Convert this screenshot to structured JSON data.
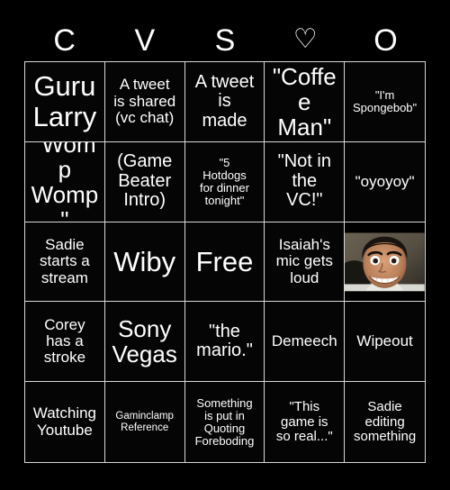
{
  "card": {
    "background_color": "#000000",
    "grid_line_color": "#d8d8d8",
    "text_color": "#ffffff",
    "columns": 5,
    "rows": 5
  },
  "header": {
    "letters": [
      {
        "label": "C",
        "name": "header-letter-c"
      },
      {
        "label": "V",
        "name": "header-letter-v"
      },
      {
        "label": "S",
        "name": "header-letter-s"
      },
      {
        "label": "♡",
        "name": "heart-icon"
      },
      {
        "label": "O",
        "name": "header-letter-o"
      }
    ]
  },
  "grid": {
    "cells": [
      {
        "text": "Guru\nLarry",
        "size": "fs-xxl",
        "type": "text"
      },
      {
        "text": "A tweet\nis shared\n(vc chat)",
        "size": "fs-m",
        "type": "text"
      },
      {
        "text": "A tweet\nis\nmade",
        "size": "fs-l",
        "type": "text"
      },
      {
        "text": "\"Coffee\nMan\"",
        "size": "fs-xl",
        "type": "text"
      },
      {
        "text": "\"I'm\nSpongebob\"",
        "size": "fs-xs",
        "type": "text"
      },
      {
        "text": "\"Womp\nWomp\"",
        "size": "fs-xl",
        "type": "text"
      },
      {
        "text": "(Game\nBeater\nIntro)",
        "size": "fs-l",
        "type": "text"
      },
      {
        "text": "\"5\nHotdogs\nfor dinner\ntonight\"",
        "size": "fs-xs",
        "type": "text"
      },
      {
        "text": "\"Not in\nthe\nVC!\"",
        "size": "fs-l",
        "type": "text"
      },
      {
        "text": "\"oyoyoy\"",
        "size": "fs-m",
        "type": "text"
      },
      {
        "text": "Sadie\nstarts a\nstream",
        "size": "fs-m",
        "type": "text"
      },
      {
        "text": "Wiby",
        "size": "fs-xxl",
        "type": "text"
      },
      {
        "text": "Free",
        "size": "fs-xxl",
        "type": "text"
      },
      {
        "text": "Isaiah's\nmic gets\nloud",
        "size": "fs-m",
        "type": "text"
      },
      {
        "text": "",
        "size": "fs-m",
        "type": "image",
        "image_name": "smiling-man-photo"
      },
      {
        "text": "Corey\nhas a\nstroke",
        "size": "fs-m",
        "type": "text"
      },
      {
        "text": "Sony\nVegas",
        "size": "fs-xl",
        "type": "text"
      },
      {
        "text": "\"the\nmario.\"",
        "size": "fs-l",
        "type": "text"
      },
      {
        "text": "Demeech",
        "size": "fs-m",
        "type": "text"
      },
      {
        "text": "Wipeout",
        "size": "fs-m",
        "type": "text"
      },
      {
        "text": "Watching\nYoutube",
        "size": "fs-m",
        "type": "text"
      },
      {
        "text": "Gaminclamp\nReference",
        "size": "fs-xxs",
        "type": "text"
      },
      {
        "text": "Something\nis put in\nQuoting\nForeboding",
        "size": "fs-xs",
        "type": "text"
      },
      {
        "text": "\"This\ngame is\nso real...\"",
        "size": "fs-s",
        "type": "text"
      },
      {
        "text": "Sadie\nediting\nsomething",
        "size": "fs-s",
        "type": "text"
      }
    ]
  }
}
